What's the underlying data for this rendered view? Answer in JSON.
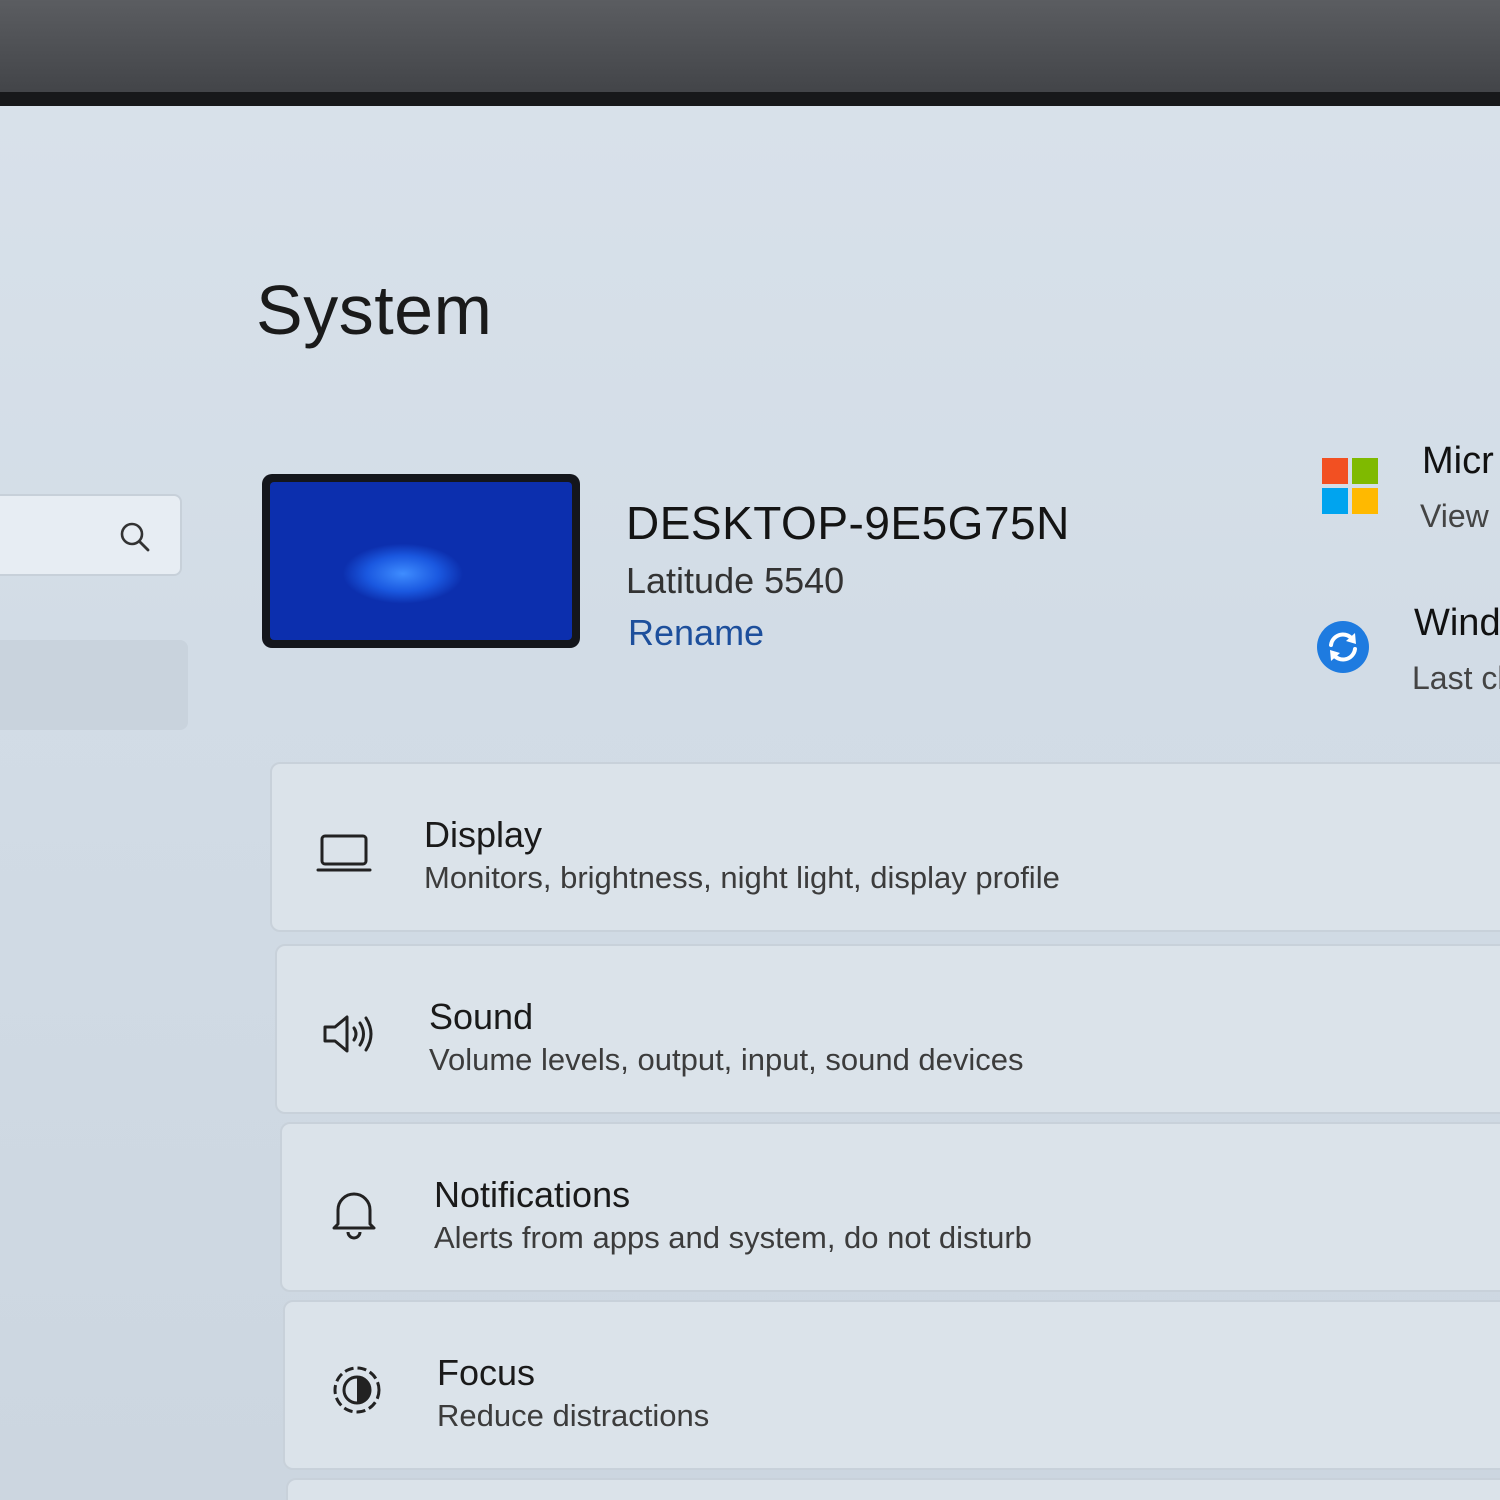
{
  "page": {
    "title": "System"
  },
  "search": {
    "placeholder": ""
  },
  "device": {
    "name": "DESKTOP-9E5G75N",
    "model": "Latitude 5540",
    "rename_label": "Rename"
  },
  "side_panel": {
    "microsoft": {
      "title": "Micr",
      "subtitle": "View",
      "icon": "windows-logo-icon"
    },
    "windows_update": {
      "title": "Wind",
      "subtitle": "Last cl",
      "icon": "sync-icon"
    }
  },
  "settings": [
    {
      "title": "Display",
      "subtitle": "Monitors, brightness, night light, display profile",
      "icon": "laptop-icon"
    },
    {
      "title": "Sound",
      "subtitle": "Volume levels, output, input, sound devices",
      "icon": "speaker-icon"
    },
    {
      "title": "Notifications",
      "subtitle": "Alerts from apps and system, do not disturb",
      "icon": "bell-icon"
    },
    {
      "title": "Focus",
      "subtitle": "Reduce distractions",
      "icon": "focus-icon"
    }
  ],
  "colors": {
    "accent_link": "#1d4f9c",
    "ms_red": "#f25022",
    "ms_green": "#7fba00",
    "ms_blue": "#00a4ef",
    "ms_yellow": "#ffb900",
    "sync_blue": "#1e7be0"
  }
}
